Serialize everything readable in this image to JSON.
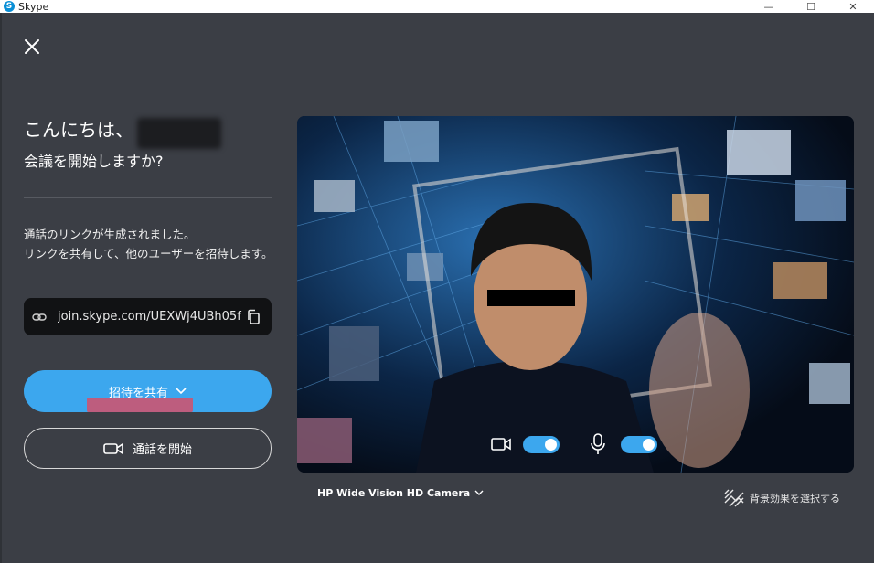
{
  "window": {
    "app_title": "Skype",
    "minimize": "—",
    "maximize": "☐",
    "close": "✕"
  },
  "greeting": {
    "hello": "こんにちは、",
    "question": "会議を開始しますか?"
  },
  "info": {
    "line1": "通話のリンクが生成されました。",
    "line2": "リンクを共有して、他のユーザーを招待します。"
  },
  "link": {
    "url": "join.skype.com/UEXWj4UBh05f"
  },
  "buttons": {
    "share": "招待を共有",
    "start_call": "通話を開始"
  },
  "video": {
    "camera_name": "HP Wide Vision HD Camera",
    "camera_on": true,
    "mic_on": true
  },
  "background_effect": {
    "label": "背景効果を選択する"
  },
  "colors": {
    "accent": "#3ca7ee",
    "background": "#3b3e45",
    "link_box": "#111214"
  },
  "icons": [
    "skype-logo-icon",
    "close-icon",
    "link-icon",
    "copy-icon",
    "chevron-down-icon",
    "video-camera-icon",
    "microphone-icon",
    "background-effect-icon"
  ]
}
